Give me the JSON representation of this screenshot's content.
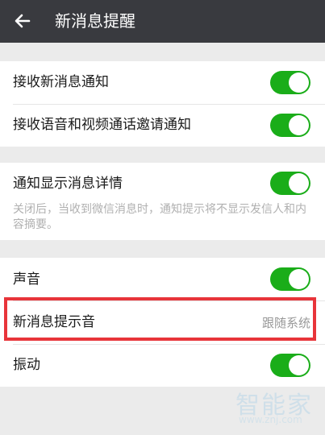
{
  "header": {
    "title": "新消息提醒",
    "back_icon": "arrow-left-icon"
  },
  "groups": {
    "g1": {
      "rows": [
        {
          "label": "接收新消息通知",
          "toggle": true
        },
        {
          "label": "接收语音和视频通话邀请通知",
          "toggle": true
        }
      ]
    },
    "g2": {
      "row": {
        "label": "通知显示消息详情",
        "toggle": true
      },
      "description": "关闭后，当收到微信消息时，通知提示将不显示发信人和内容摘要。"
    },
    "g3": {
      "rows": [
        {
          "label": "声音",
          "toggle": true
        },
        {
          "label": "新消息提示音",
          "value": "跟随系统"
        },
        {
          "label": "振动",
          "toggle": true
        }
      ]
    }
  },
  "watermark": {
    "text": "智能家",
    "url": "www.znj.com"
  },
  "colors": {
    "header_bg": "#393a3f",
    "toggle_on": "#1aad19",
    "highlight": "#e8343a"
  }
}
